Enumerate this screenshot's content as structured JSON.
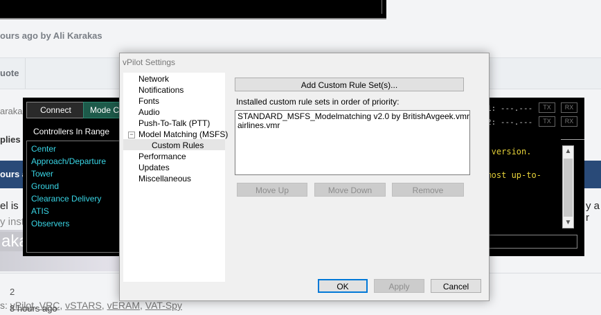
{
  "background_page": {
    "byline": "ours ago by Ali Karakas",
    "quote_label": "uote",
    "author_fragment": "araka",
    "replies_fragment": "plies",
    "hours_fragment": "ours a",
    "body_fragment_1": "el is",
    "body_fragment_2": "y inst",
    "body_fragment_right": "y a r",
    "name_fragment": "akas",
    "reply_count": "2",
    "tags": [
      "vPilot",
      "VRC",
      "vSTARS",
      "vERAM",
      "VAT-Spy"
    ],
    "tags_prefix": "s:",
    "time_ago": "8 hours ago"
  },
  "client": {
    "connect_label": "Connect",
    "mode_label": "Mode C",
    "controllers_header": "Controllers In Range",
    "controllers": [
      "Center",
      "Approach/Departure",
      "Tower",
      "Ground",
      "Clearance Delivery",
      "ATIS",
      "Observers"
    ],
    "com1_fragment": "1:  ---.---",
    "com2_fragment": "2:  ---.---",
    "tx_label": "TX",
    "rx_label": "RX",
    "messages": [
      "st version.",
      "e most up-to-"
    ],
    "scroll_up": "▲",
    "scroll_down": "▼"
  },
  "dialog": {
    "title": "vPilot Settings",
    "tree": [
      "Network",
      "Notifications",
      "Fonts",
      "Audio",
      "Push-To-Talk (PTT)",
      "Model Matching (MSFS)",
      "Custom Rules",
      "Performance",
      "Updates",
      "Miscellaneous"
    ],
    "tree_collapse_glyph": "−",
    "selected_item": "Custom Rules",
    "add_button": "Add Custom Rule Set(s)...",
    "installed_label": "Installed custom rule sets in order of priority:",
    "rule_sets": [
      "STANDARD_MSFS_Modelmatching v2.0 by BritishAvgeek.vmr",
      "airlines.vmr"
    ],
    "move_up": "Move Up",
    "move_down": "Move Down",
    "remove": "Remove",
    "ok": "OK",
    "apply": "Apply",
    "cancel": "Cancel"
  }
}
